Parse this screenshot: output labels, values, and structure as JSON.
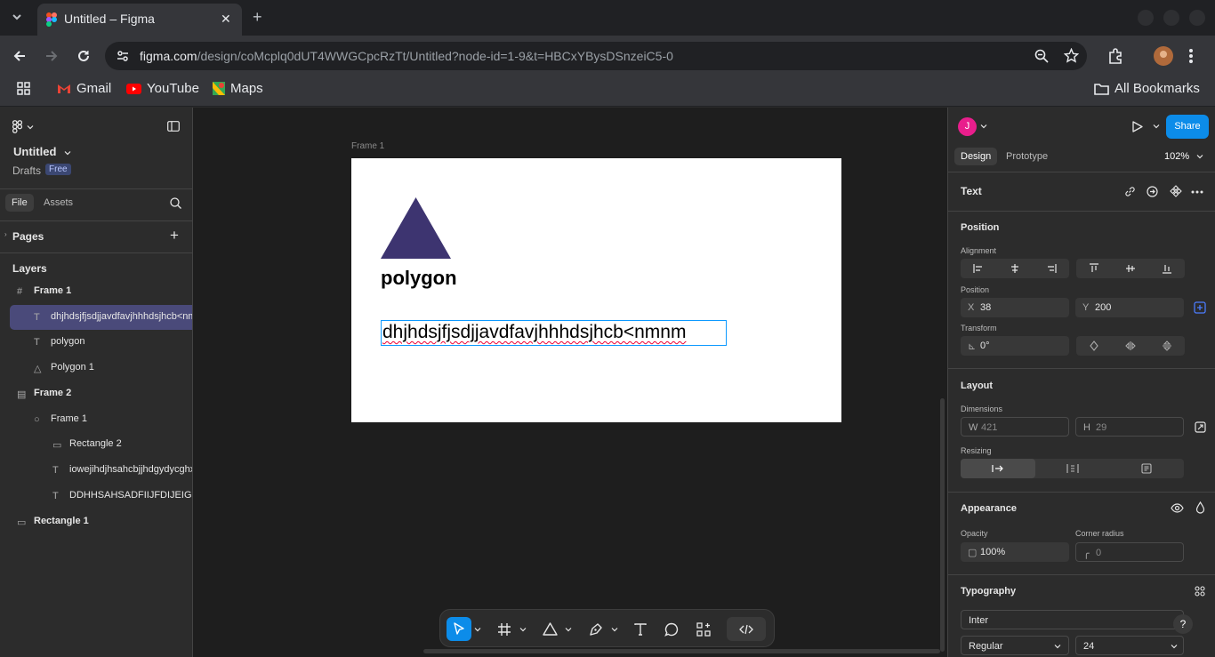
{
  "browser": {
    "tab_title": "Untitled – Figma",
    "url_host": "figma.com",
    "url_path": "/design/coMcplq0dUT4WWGCpcRzTt/Untitled?node-id=1-9&t=HBCxYBysDSnzeiC5-0",
    "bookmarks": [
      {
        "label": "Gmail",
        "icon": "gmail-icon"
      },
      {
        "label": "YouTube",
        "icon": "youtube-icon"
      },
      {
        "label": "Maps",
        "icon": "maps-icon"
      }
    ],
    "all_bookmarks": "All Bookmarks"
  },
  "left_panel": {
    "file_name": "Untitled",
    "location": "Drafts",
    "plan_badge": "Free",
    "tabs": [
      "File",
      "Assets"
    ],
    "pages_label": "Pages",
    "layers_label": "Layers",
    "layers": [
      {
        "name": "Frame 1",
        "icon": "frame-icon",
        "indent": 0,
        "selected": false
      },
      {
        "name": "dhjhdsjfjsdjjavdfavjhhhdsjhcb<nmnm",
        "icon": "text-icon",
        "indent": 1,
        "selected": true
      },
      {
        "name": "polygon",
        "icon": "text-icon",
        "indent": 1,
        "selected": false
      },
      {
        "name": "Polygon 1",
        "icon": "polygon-icon",
        "indent": 1,
        "selected": false
      },
      {
        "name": "Frame 2",
        "icon": "autolayout-frame-icon",
        "indent": 0,
        "selected": false
      },
      {
        "name": "Frame 1",
        "icon": "ellipse-icon",
        "indent": 1,
        "selected": false
      },
      {
        "name": "Rectangle 2",
        "icon": "rectangle-icon",
        "indent": 2,
        "selected": false
      },
      {
        "name": "iowejihdjhsahcbjjhdgydycghxbjhsad",
        "icon": "text-icon",
        "indent": 2,
        "selected": false
      },
      {
        "name": "DDHHSAHSADFIIJFDIJEIGSSDJHDA",
        "icon": "text-icon",
        "indent": 2,
        "selected": false
      },
      {
        "name": "Rectangle 1",
        "icon": "rectangle-icon",
        "indent": 0,
        "selected": false
      }
    ]
  },
  "canvas": {
    "frame_label": "Frame 1",
    "polygon_text": "polygon",
    "polygon_color": "#3d3470",
    "selected_text": "dhjhdsjfjsdjjavdfavjhhhdsjhcb<nmnm"
  },
  "right_panel": {
    "avatar_initial": "J",
    "share_label": "Share",
    "tabs": [
      "Design",
      "Prototype"
    ],
    "zoom": "102%",
    "selection_type": "Text",
    "position_section": "Position",
    "alignment_label": "Alignment",
    "position_label": "Position",
    "x_label": "X",
    "x_value": "38",
    "y_label": "Y",
    "y_value": "200",
    "transform_label": "Transform",
    "rotation": "0°",
    "layout_section": "Layout",
    "dimensions_label": "Dimensions",
    "w_label": "W",
    "w_value": "421",
    "h_label": "H",
    "h_value": "29",
    "resizing_label": "Resizing",
    "appearance_section": "Appearance",
    "opacity_label": "Opacity",
    "opacity_value": "100%",
    "corner_radius_label": "Corner radius",
    "corner_radius_value": "0",
    "typography_section": "Typography",
    "font_family": "Inter",
    "font_weight": "Regular",
    "font_size": "24"
  },
  "colors": {
    "accent": "#0d99ff",
    "share": "#0c8ce9",
    "selected_layer": "#4a4a7a",
    "avatar": "#e91e8c"
  }
}
